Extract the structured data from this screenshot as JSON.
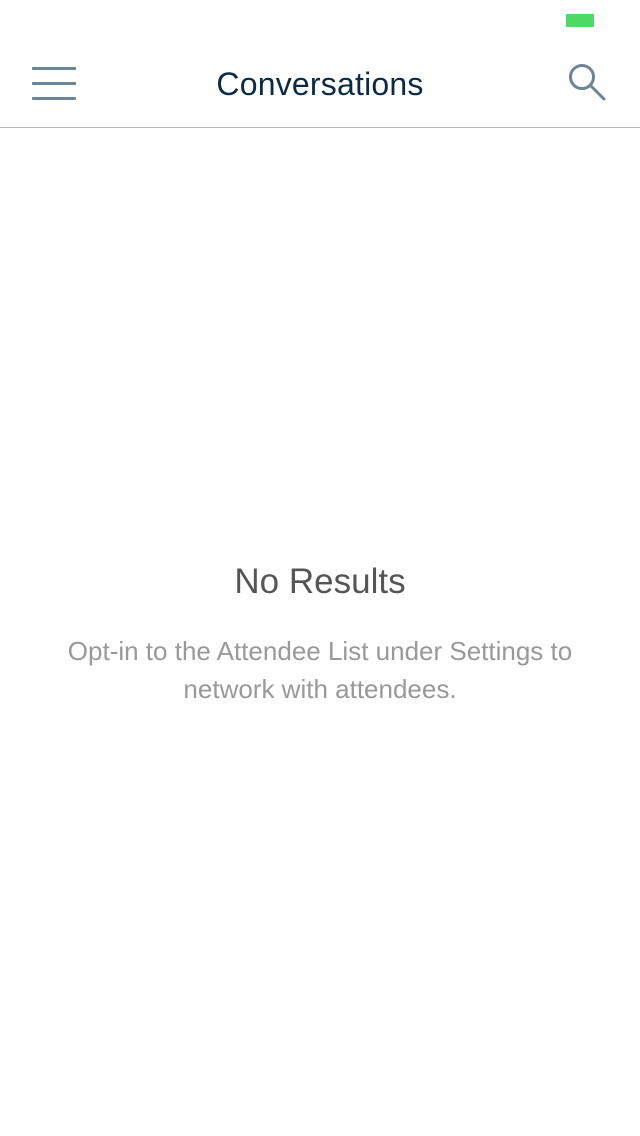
{
  "status_bar": {
    "battery_color": "#4cd964"
  },
  "nav": {
    "title": "Conversations",
    "menu_icon": "hamburger-menu-icon",
    "search_icon": "search-icon",
    "icon_color": "#6a8597",
    "title_color": "#0b2a45"
  },
  "empty_state": {
    "title": "No Results",
    "message": "Opt-in to the Attendee List under Settings to network with attendees."
  }
}
